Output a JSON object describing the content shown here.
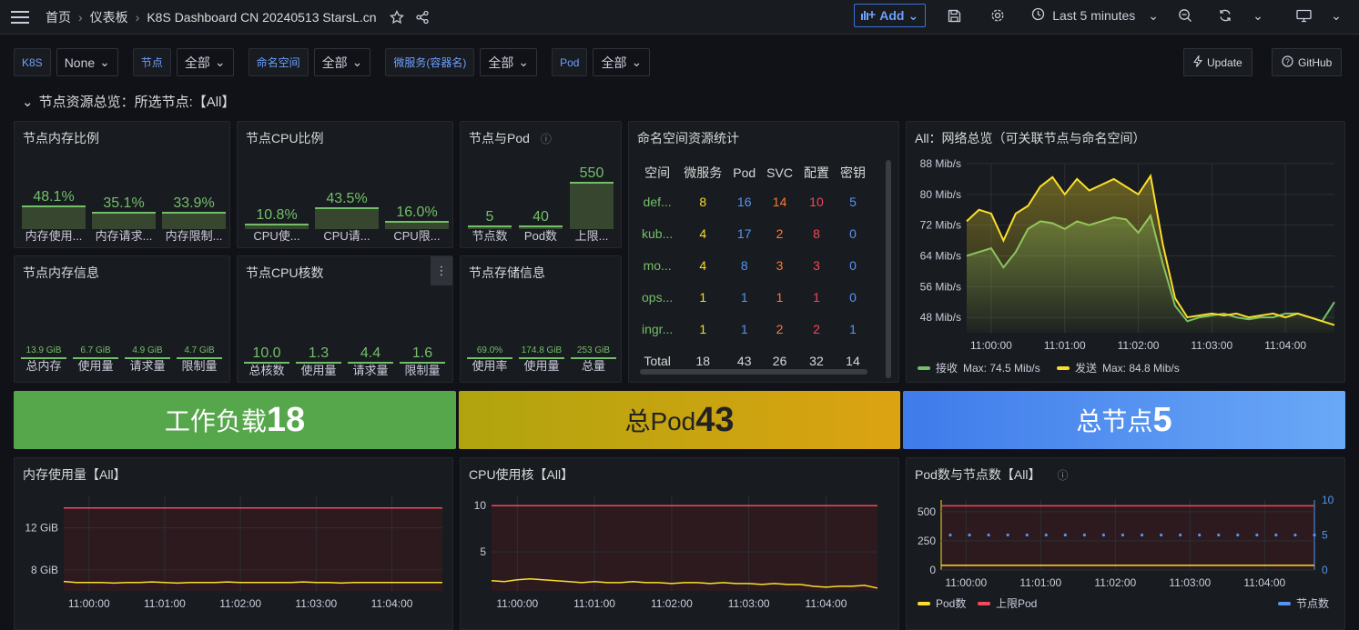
{
  "topbar": {
    "breadcrumb": [
      "首页",
      "仪表板",
      "K8S Dashboard CN 20240513 StarsL.cn"
    ],
    "add_label": "Add",
    "time_range": "Last 5 minutes"
  },
  "variables": [
    {
      "label": "K8S",
      "value": "None"
    },
    {
      "label": "节点",
      "value": "全部"
    },
    {
      "label": "命名空间",
      "value": "全部"
    },
    {
      "label": "微服务(容器名)",
      "value": "全部"
    },
    {
      "label": "Pod",
      "value": "全部"
    }
  ],
  "links": {
    "update": "Update",
    "github": "GitHub"
  },
  "row_title": "节点资源总览：所选节点:【All】",
  "mem_ratio": {
    "title": "节点内存比例",
    "items": [
      {
        "value": "48.1%",
        "label": "内存使用...",
        "v": 48.1
      },
      {
        "value": "35.1%",
        "label": "内存请求...",
        "v": 35.1
      },
      {
        "value": "33.9%",
        "label": "内存限制...",
        "v": 33.9
      }
    ]
  },
  "cpu_ratio": {
    "title": "节点CPU比例",
    "items": [
      {
        "value": "10.8%",
        "label": "CPU使...",
        "v": 10.8
      },
      {
        "value": "43.5%",
        "label": "CPU请...",
        "v": 43.5
      },
      {
        "value": "16.0%",
        "label": "CPU限...",
        "v": 16.0
      }
    ]
  },
  "node_pod": {
    "title": "节点与Pod",
    "items": [
      {
        "value": "5",
        "label": "节点数",
        "v": 5
      },
      {
        "value": "40",
        "label": "Pod数",
        "v": 40
      },
      {
        "value": "550",
        "label": "上限...",
        "v": 550
      }
    ]
  },
  "mem_info": {
    "title": "节点内存信息",
    "items": [
      {
        "value": "13.9 GiB",
        "label": "总内存"
      },
      {
        "value": "6.7 GiB",
        "label": "使用量"
      },
      {
        "value": "4.9 GiB",
        "label": "请求量"
      },
      {
        "value": "4.7 GiB",
        "label": "限制量"
      }
    ]
  },
  "cpu_cores": {
    "title": "节点CPU核数",
    "items": [
      {
        "value": "10.0",
        "label": "总核数"
      },
      {
        "value": "1.3",
        "label": "使用量"
      },
      {
        "value": "4.4",
        "label": "请求量"
      },
      {
        "value": "1.6",
        "label": "限制量"
      }
    ]
  },
  "storage": {
    "title": "节点存储信息",
    "items": [
      {
        "value": "69.0%",
        "label": "使用率"
      },
      {
        "value": "174.8 GiB",
        "label": "使用量"
      },
      {
        "value": "253 GiB",
        "label": "总量"
      }
    ]
  },
  "ns_table": {
    "title": "命名空间资源统计",
    "headers": [
      "空间",
      "微服务",
      "Pod",
      "SVC",
      "配置",
      "密钥"
    ],
    "rows": [
      [
        "def...",
        "8",
        "16",
        "14",
        "10",
        "5"
      ],
      [
        "kub...",
        "4",
        "17",
        "2",
        "8",
        "0"
      ],
      [
        "mo...",
        "4",
        "8",
        "3",
        "3",
        "0"
      ],
      [
        "ops...",
        "1",
        "1",
        "1",
        "1",
        "0"
      ],
      [
        "ingr...",
        "1",
        "1",
        "2",
        "2",
        "1"
      ]
    ],
    "total": [
      "Total",
      "18",
      "43",
      "26",
      "32",
      "14"
    ]
  },
  "stats": [
    {
      "label": "工作负载",
      "value": "18"
    },
    {
      "label": "总Pod",
      "value": "43"
    },
    {
      "label": "总节点",
      "value": "5"
    }
  ],
  "colors": {
    "green": "#73bf69",
    "yellow": "#fade2a",
    "red": "#f2495c",
    "blue": "#5794f2",
    "stat1": "#56a64b",
    "stat2": "#c4a20a",
    "stat3": "#5794f2"
  },
  "chart_data": [
    {
      "title": "All：网络总览（可关联节点与命名空间）",
      "type": "area",
      "x": [
        "10:59:40",
        "10:59:50",
        "11:00:00",
        "11:00:10",
        "11:00:20",
        "11:00:30",
        "11:00:40",
        "11:00:50",
        "11:01:00",
        "11:01:10",
        "11:01:20",
        "11:01:30",
        "11:01:40",
        "11:01:50",
        "11:02:00",
        "11:02:10",
        "11:02:20",
        "11:02:30",
        "11:02:40",
        "11:02:50",
        "11:03:00",
        "11:03:10",
        "11:03:20",
        "11:03:30",
        "11:03:40",
        "11:03:50",
        "11:04:00",
        "11:04:10",
        "11:04:20",
        "11:04:30",
        "11:04:40"
      ],
      "xticks": [
        "11:00:00",
        "11:01:00",
        "11:02:00",
        "11:03:00",
        "11:04:00"
      ],
      "yticks": [
        "48 Mib/s",
        "56 Mib/s",
        "64 Mib/s",
        "72 Mib/s",
        "80 Mib/s",
        "88 Mib/s"
      ],
      "ylim": [
        44,
        88
      ],
      "series": [
        {
          "name": "接收",
          "values": [
            64,
            65,
            66,
            61,
            65,
            71,
            73,
            72.5,
            71,
            73,
            72,
            73,
            74,
            73.5,
            70,
            74.5,
            62,
            51,
            47,
            48,
            48.5,
            49,
            48,
            47.5,
            48,
            48,
            49,
            49,
            48,
            47,
            52
          ],
          "legend": "Max: 74.5 Mib/s",
          "color": "#73bf69"
        },
        {
          "name": "发送",
          "values": [
            73,
            76,
            75,
            68,
            75,
            77,
            82,
            84.5,
            80,
            84,
            81,
            82.5,
            84,
            82,
            80,
            84.8,
            67,
            53,
            48,
            48.5,
            49,
            48.5,
            49,
            48,
            48.5,
            49,
            48,
            49,
            48,
            47,
            46
          ],
          "legend": "Max: 84.8 Mib/s",
          "color": "#fade2a"
        }
      ]
    },
    {
      "title": "内存使用量【All】",
      "type": "line",
      "xticks": [
        "11:00:00",
        "11:01:00",
        "11:02:00",
        "11:03:00",
        "11:04:00"
      ],
      "yticks": [
        "8 GiB",
        "12 GiB"
      ],
      "ylim": [
        6,
        15
      ],
      "series": [
        {
          "name": "",
          "values": [
            13.9,
            13.9,
            13.9,
            13.9,
            13.9,
            13.9,
            13.9,
            13.9,
            13.9,
            13.9,
            13.9,
            13.9,
            13.9,
            13.9,
            13.9,
            13.9,
            13.9,
            13.9,
            13.9,
            13.9,
            13.9,
            13.9,
            13.9,
            13.9,
            13.9,
            13.9,
            13.9,
            13.9,
            13.9,
            13.9,
            13.9
          ],
          "color": "#f2495c"
        },
        {
          "name": "",
          "values": [
            6.9,
            6.8,
            6.8,
            6.8,
            6.75,
            6.8,
            6.8,
            6.85,
            6.8,
            6.75,
            6.8,
            6.8,
            6.8,
            6.85,
            6.8,
            6.8,
            6.8,
            6.8,
            6.8,
            6.85,
            6.8,
            6.8,
            6.75,
            6.8,
            6.8,
            6.8,
            6.8,
            6.8,
            6.8,
            6.8,
            6.8
          ],
          "color": "#fade2a"
        }
      ]
    },
    {
      "title": "CPU使用核【All】",
      "type": "line",
      "xticks": [
        "11:00:00",
        "11:01:00",
        "11:02:00",
        "11:03:00",
        "11:04:00"
      ],
      "yticks": [
        "5",
        "10"
      ],
      "ylim": [
        0.8,
        11
      ],
      "series": [
        {
          "name": "",
          "values": [
            10,
            10,
            10,
            10,
            10,
            10,
            10,
            10,
            10,
            10,
            10,
            10,
            10,
            10,
            10,
            10,
            10,
            10,
            10,
            10,
            10,
            10,
            10,
            10,
            10,
            10,
            10,
            10,
            10,
            10,
            10
          ],
          "color": "#f2495c"
        },
        {
          "name": "",
          "values": [
            1.9,
            1.8,
            2,
            2.1,
            2,
            1.9,
            1.8,
            1.7,
            1.8,
            1.7,
            1.7,
            1.8,
            1.7,
            1.7,
            1.6,
            1.7,
            1.7,
            1.6,
            1.7,
            1.6,
            1.6,
            1.5,
            1.6,
            1.5,
            1.5,
            1.3,
            1.2,
            1.3,
            1.3,
            1.4,
            1.1
          ],
          "color": "#fade2a"
        }
      ]
    },
    {
      "title": "Pod数与节点数【All】",
      "type": "line",
      "xticks": [
        "11:00:00",
        "11:01:00",
        "11:02:00",
        "11:03:00",
        "11:04:00"
      ],
      "yticks_left": [
        "0",
        "250",
        "500"
      ],
      "yticks_right": [
        "0",
        "5",
        "10"
      ],
      "ylim": [
        0,
        600
      ],
      "ylim_right": [
        0,
        10
      ],
      "series": [
        {
          "name": "Pod数",
          "values": [
            40,
            40,
            40,
            40,
            40,
            40,
            40,
            40,
            40,
            40,
            40,
            40,
            40,
            40,
            40,
            40,
            40,
            40,
            40,
            40,
            40,
            40,
            40,
            40,
            40,
            40,
            40,
            40,
            40,
            40,
            40
          ],
          "color": "#fade2a"
        },
        {
          "name": "上限Pod",
          "values": [
            550,
            550,
            550,
            550,
            550,
            550,
            550,
            550,
            550,
            550,
            550,
            550,
            550,
            550,
            550,
            550,
            550,
            550,
            550,
            550,
            550,
            550,
            550,
            550,
            550,
            550,
            550,
            550,
            550,
            550,
            550
          ],
          "color": "#f2495c"
        },
        {
          "name": "节点数",
          "values": [
            5,
            5,
            5,
            5,
            5,
            5,
            5,
            5,
            5,
            5,
            5,
            5,
            5,
            5,
            5,
            5,
            5,
            5,
            5,
            5
          ],
          "color": "#5794f2",
          "axis": "right"
        }
      ]
    }
  ]
}
